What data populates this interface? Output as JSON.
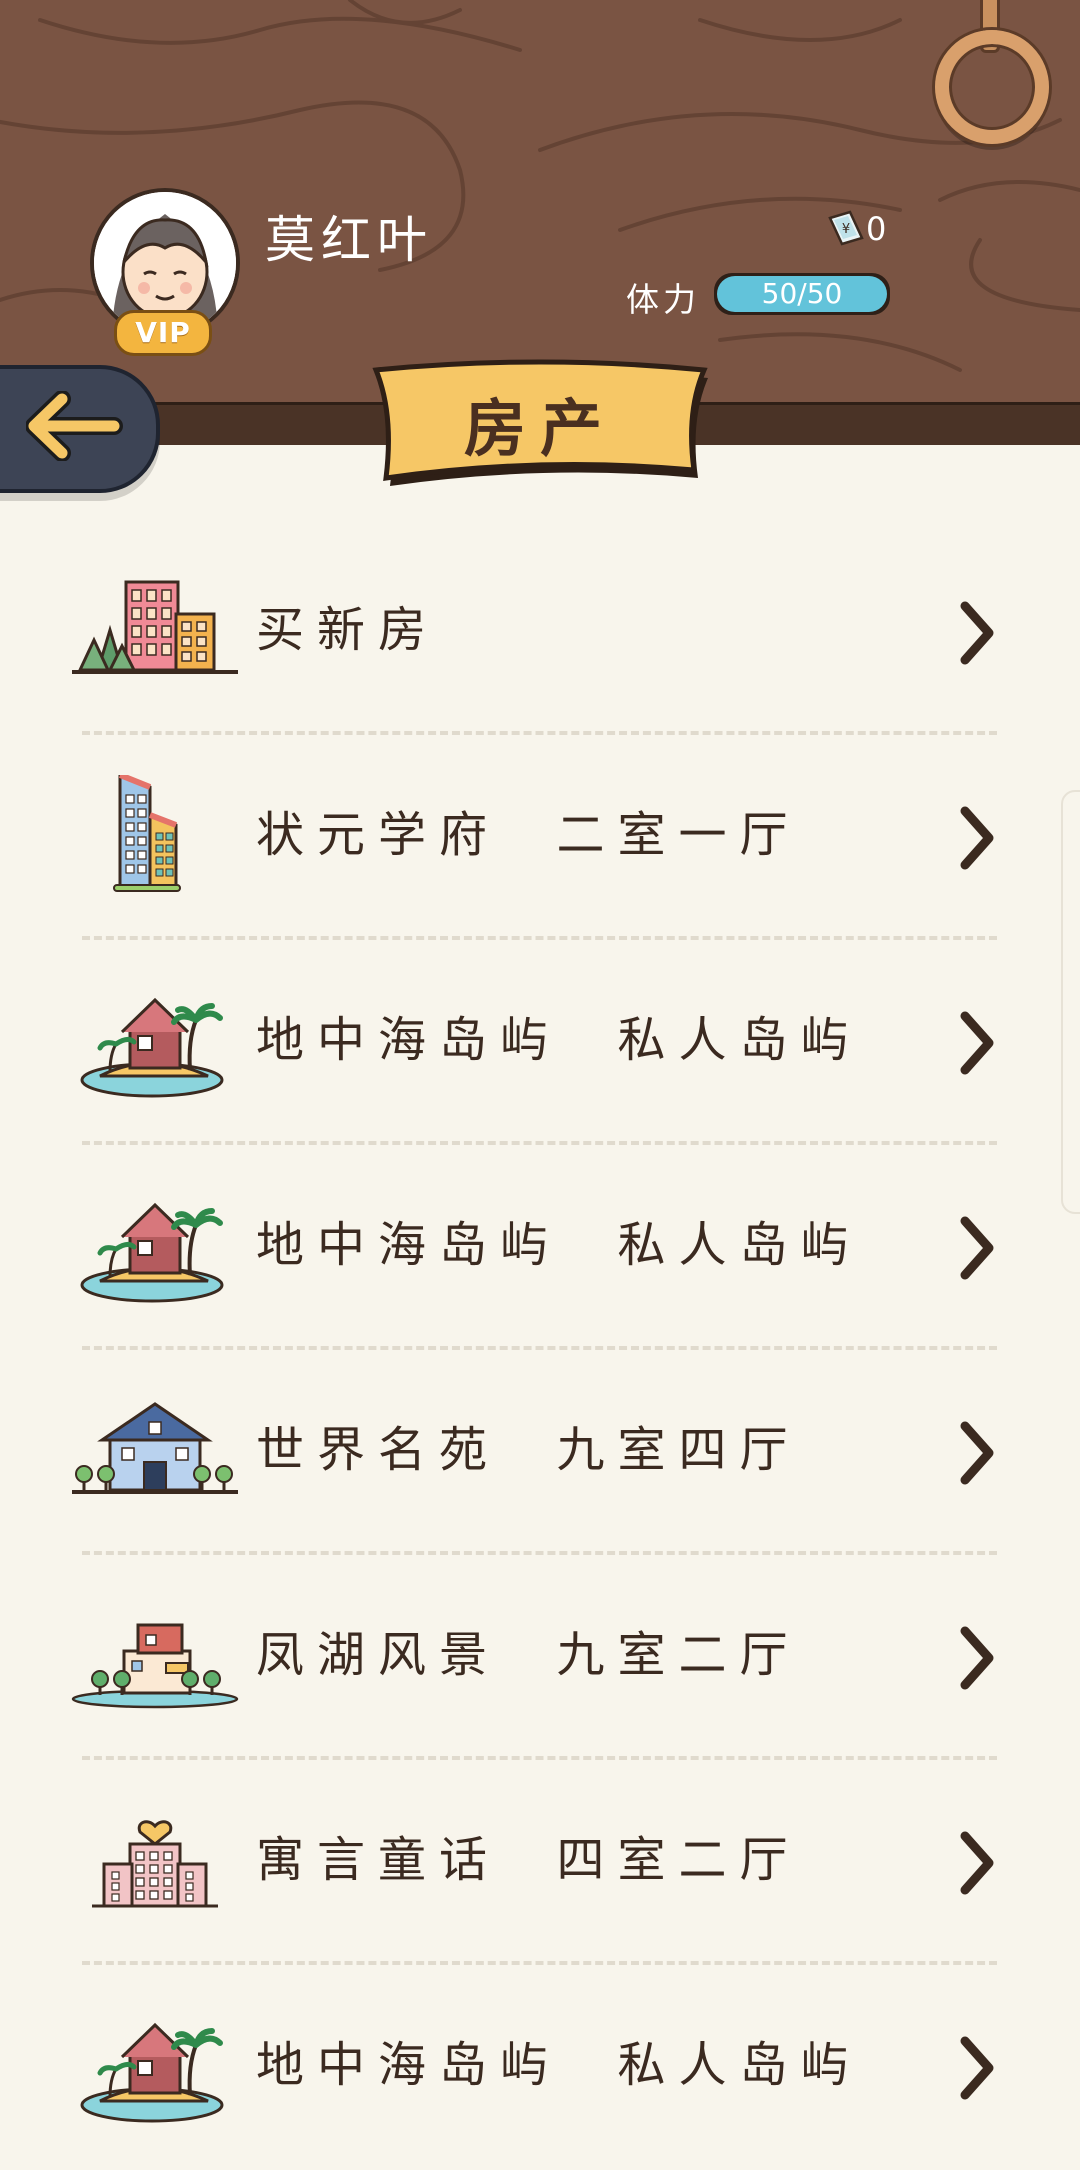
{
  "profile": {
    "name": "莫红叶",
    "vip_label": "VIP",
    "money_value": "0",
    "stamina_label": "体力",
    "stamina_text": "50/50",
    "stamina_fraction": 1.0
  },
  "page": {
    "title": "房产"
  },
  "colors": {
    "header_wood": "#7a5443",
    "page_bg": "#f8f5ec",
    "banner_yellow": "#f6c766",
    "back_button": "#3d4455",
    "stamina_fill": "#62c3da",
    "text_dark": "#3b2a20"
  },
  "properties": [
    {
      "label": "买新房",
      "icon": "city-buildings-icon"
    },
    {
      "label": "状元学府  二室一厅",
      "icon": "apartment-tower-icon"
    },
    {
      "label": "地中海岛屿  私人岛屿",
      "icon": "island-house-icon"
    },
    {
      "label": "地中海岛屿  私人岛屿",
      "icon": "island-house-icon"
    },
    {
      "label": "世界名苑  九室四厅",
      "icon": "villa-icon"
    },
    {
      "label": "凤湖风景  九室二厅",
      "icon": "lakeside-villa-icon"
    },
    {
      "label": "寓言童话  四室二厅",
      "icon": "heart-tower-icon"
    },
    {
      "label": "地中海岛屿  私人岛屿",
      "icon": "island-house-icon"
    }
  ]
}
